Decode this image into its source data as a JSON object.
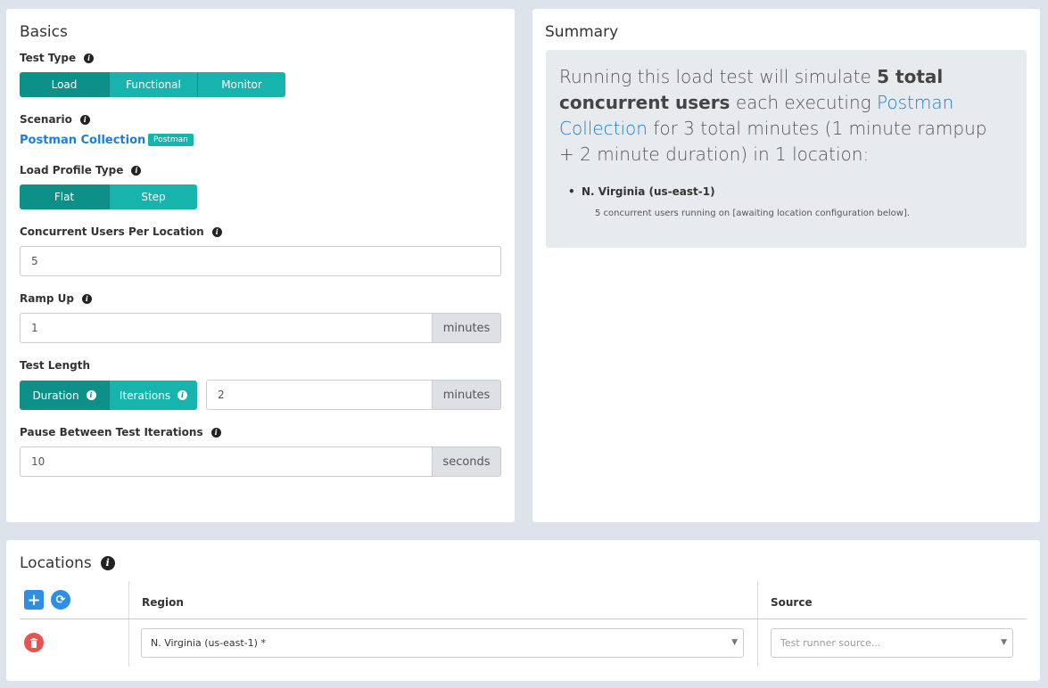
{
  "basics": {
    "title": "Basics",
    "test_type_label": "Test Type",
    "test_types": [
      "Load",
      "Functional",
      "Monitor"
    ],
    "scenario_label": "Scenario",
    "scenario_link": "Postman Collection",
    "scenario_badge": "Postman",
    "load_profile_label": "Load Profile Type",
    "load_profiles": [
      "Flat",
      "Step"
    ],
    "concurrent_label": "Concurrent Users Per Location",
    "concurrent_value": "5",
    "ramp_label": "Ramp Up",
    "ramp_value": "1",
    "ramp_unit": "minutes",
    "length_label": "Test Length",
    "length_modes": [
      "Duration",
      "Iterations"
    ],
    "length_value": "2",
    "length_unit": "minutes",
    "pause_label": "Pause Between Test Iterations",
    "pause_value": "10",
    "pause_unit": "seconds"
  },
  "summary": {
    "title": "Summary",
    "text_prefix": "Running this load test will simulate ",
    "text_users": "5 total concurrent users",
    "text_mid": " each executing ",
    "text_link": "Postman Collection",
    "text_suffix": " for 3 total minutes (1 minute rampup + 2 minute duration) in 1 location:",
    "location_name": "N. Virginia (us-east-1)",
    "location_detail": "5 concurrent users running on [awaiting location configuration below]."
  },
  "locations": {
    "title": "Locations",
    "col_region": "Region",
    "col_source": "Source",
    "rows": [
      {
        "region": "N. Virginia (us-east-1) *",
        "source_placeholder": "Test runner source..."
      }
    ]
  },
  "colors": {
    "teal": "#17b3ad",
    "teal_active": "#0d9088",
    "link_blue": "#1a7fdc",
    "delete_red": "#e8534f"
  }
}
